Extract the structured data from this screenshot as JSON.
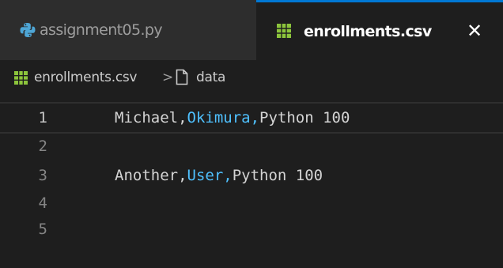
{
  "tabs": [
    {
      "label": "assignment05.py",
      "icon": "python-icon",
      "active": false
    },
    {
      "label": "enrollments.csv",
      "icon": "csv-icon",
      "active": true,
      "close_glyph": "✕"
    }
  ],
  "breadcrumb": {
    "file": "enrollments.csv",
    "separator": ">",
    "symbol": "data"
  },
  "editor": {
    "lines": [
      {
        "number": "1",
        "col1": "Michael,",
        "col2": "Okimura,",
        "col3": "Python 100"
      },
      {
        "number": "2",
        "col1": "",
        "col2": "",
        "col3": ""
      },
      {
        "number": "3",
        "col1": "Another,",
        "col2": "User,",
        "col3": "Python 100"
      },
      {
        "number": "4",
        "col1": "",
        "col2": "",
        "col3": ""
      },
      {
        "number": "5",
        "col1": "",
        "col2": "",
        "col3": ""
      }
    ],
    "current_line": "1"
  },
  "colors": {
    "tab_active_border": "#0078d4",
    "csv_icon": "#8cc43c",
    "python_icon": "#4ea6d6",
    "second_column": "#4fc1ff"
  }
}
